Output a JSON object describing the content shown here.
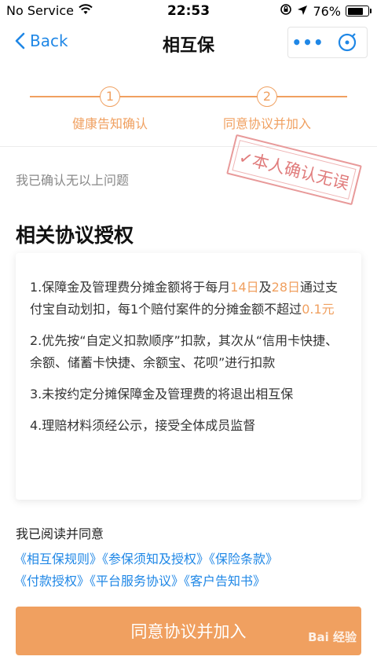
{
  "status_bar": {
    "carrier": "No Service",
    "time": "22:53",
    "battery": "76%",
    "battery_level": 0.76,
    "icons": [
      "wifi-icon",
      "rotation-lock-icon",
      "location-arrow-icon",
      "battery-icon"
    ]
  },
  "nav": {
    "back_label": "Back",
    "title": "相互保",
    "more_label": "•••",
    "close_icon": "close-circle-icon"
  },
  "steps": [
    {
      "number": "1",
      "label": "健康告知确认"
    },
    {
      "number": "2",
      "label": "同意协议并加入"
    }
  ],
  "confirm_text": "我已确认无以上问题",
  "stamp_text": "✓本人确认无误",
  "section_title": "相关协议授权",
  "clauses": {
    "c1": {
      "a": "1.保障金及管理费分摊金额将于每月",
      "d1": "14日",
      "and": "及",
      "d2": "28日",
      "b": "通过支付宝自动划扣，每1个赔付案件的分摊金额不超过",
      "amt": "0.1元"
    },
    "c2": "2.优先按“自定义扣款顺序”扣款，其次从“信用卡快捷、余额、储蓄卡快捷、余额宝、花呗”进行扣款",
    "c3": "3.未按约定分摊保障金及管理费的将退出相互保",
    "c4": "4.理赔材料须经公示，接受全体成员监督"
  },
  "read_label": "我已阅读并同意",
  "links": [
    "《相互保规则》",
    "《参保须知及授权》",
    "《保险条款》",
    "《付款授权》",
    "《平台服务协议》",
    "《客户告知书》"
  ],
  "agree_button": "同意协议并加入",
  "watermark": "Bai 经验",
  "colors": {
    "accent": "#f0a060",
    "link": "#1f87e6",
    "stamp": "#e07b7b"
  }
}
